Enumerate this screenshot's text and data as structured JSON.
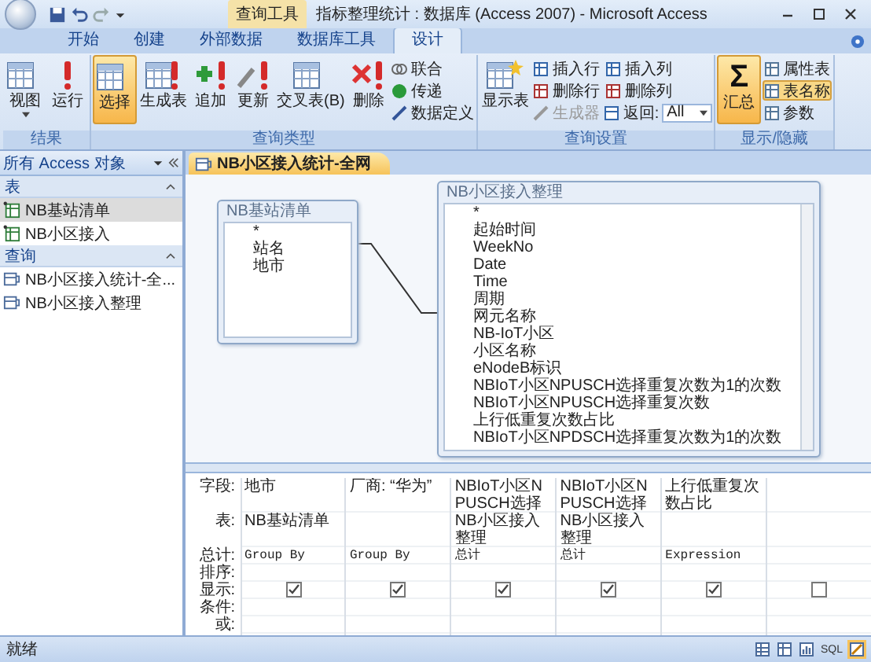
{
  "title_bar": {
    "context_tab": "查询工具",
    "title": "指标整理统计 : 数据库 (Access 2007) - Microsoft Access"
  },
  "ribbon_tabs": [
    {
      "label": "开始",
      "selected": false
    },
    {
      "label": "创建",
      "selected": false
    },
    {
      "label": "外部数据",
      "selected": false
    },
    {
      "label": "数据库工具",
      "selected": false
    },
    {
      "label": "设计",
      "selected": true
    }
  ],
  "ribbon_groups": [
    {
      "label": "结果",
      "large": [
        {
          "label": "视图",
          "kind": "grid",
          "selected": false,
          "dropdown": true
        },
        {
          "label": "运行",
          "kind": "exclaim",
          "selected": false
        }
      ]
    },
    {
      "label": "查询类型",
      "large": [
        {
          "label": "选择",
          "kind": "select",
          "selected": true
        },
        {
          "label": "生成表",
          "kind": "make-table",
          "selected": false
        },
        {
          "label": "追加",
          "kind": "append",
          "selected": false
        },
        {
          "label": "更新",
          "kind": "update",
          "selected": false
        },
        {
          "label": "交叉表(B)",
          "kind": "crosstab",
          "selected": false
        },
        {
          "label": "删除",
          "kind": "delete",
          "selected": false
        }
      ],
      "small": [
        {
          "label": "联合",
          "kind": "union",
          "disabled": false,
          "selected": false
        },
        {
          "label": "传递",
          "kind": "globe",
          "disabled": false,
          "selected": false
        },
        {
          "label": "数据定义",
          "kind": "pencil",
          "disabled": false,
          "selected": false
        }
      ]
    },
    {
      "label": "查询设置",
      "large": [
        {
          "label": "显示表",
          "kind": "show-table",
          "selected": false
        }
      ],
      "small": [
        {
          "label": "插入行",
          "kind": "insert-row",
          "disabled": false,
          "selected": false
        },
        {
          "label": "删除行",
          "kind": "delete-row",
          "disabled": false,
          "selected": false
        },
        {
          "label": "生成器",
          "kind": "builder",
          "disabled": true,
          "selected": false
        },
        {
          "label": "插入列",
          "kind": "insert-col",
          "disabled": false,
          "selected": false
        },
        {
          "label": "删除列",
          "kind": "delete-col",
          "disabled": false,
          "selected": false
        }
      ],
      "return": {
        "label": "返回:",
        "value": "All"
      }
    },
    {
      "label": "显示/隐藏",
      "large": [
        {
          "label": "汇总",
          "kind": "sigma",
          "symbol": "Σ",
          "selected": true
        }
      ],
      "small": [
        {
          "label": "属性表",
          "kind": "property",
          "disabled": false,
          "selected": false
        },
        {
          "label": "表名称",
          "kind": "table-names",
          "disabled": false,
          "selected": true
        },
        {
          "label": "参数",
          "kind": "params",
          "disabled": false,
          "selected": false
        }
      ]
    }
  ],
  "nav_pane": {
    "title": "所有 Access 对象",
    "sections": [
      {
        "label": "表",
        "items": [
          {
            "label": "NB基站清单",
            "kind": "table",
            "selected": true
          },
          {
            "label": "NB小区接入",
            "kind": "table",
            "selected": false
          }
        ]
      },
      {
        "label": "查询",
        "items": [
          {
            "label": "NB小区接入统计-全...",
            "kind": "query",
            "selected": false
          },
          {
            "label": "NB小区接入整理",
            "kind": "query",
            "selected": false
          }
        ]
      }
    ]
  },
  "document_tab": {
    "label": "NB小区接入统计-全网"
  },
  "tables": [
    {
      "title": "NB基站清单",
      "fields": [
        "*",
        "站名",
        "地市"
      ]
    },
    {
      "title": "NB小区接入整理",
      "fields": [
        "*",
        "起始时间",
        "WeekNo",
        "Date",
        "Time",
        "周期",
        "网元名称",
        "NB-IoT小区",
        "小区名称",
        "eNodeB标识",
        "NBIoT小区NPUSCH选择重复次数为1的次数",
        "NBIoT小区NPUSCH选择重复次数",
        "上行低重复次数占比",
        "NBIoT小区NPDSCH选择重复次数为1的次数"
      ]
    }
  ],
  "grid": {
    "row_labels": [
      "字段:",
      "表:",
      "总计:",
      "排序:",
      "显示:",
      "条件:",
      "或:"
    ],
    "columns": [
      {
        "field": "地市",
        "table": "NB基站清单",
        "total": "Group By",
        "show": true
      },
      {
        "field": "厂商: “华为”",
        "total": "Group By",
        "show": true
      },
      {
        "field": "NBIoT小区NPUSCH选择",
        "table": "NB小区接入整理",
        "total": "总计",
        "show": true
      },
      {
        "field": "NBIoT小区NPUSCH选择",
        "table": "NB小区接入整理",
        "total": "总计",
        "show": true
      },
      {
        "field": "上行低重复次数占比",
        "total": "Expression",
        "show": true
      },
      {
        "show": false
      }
    ]
  },
  "status_bar": {
    "text": "就绪",
    "views": [
      {
        "kind": "datasheet",
        "selected": false
      },
      {
        "kind": "pivot-table",
        "selected": false
      },
      {
        "kind": "pivot-chart",
        "selected": false
      },
      {
        "kind": "sql",
        "label": "SQL",
        "selected": false
      },
      {
        "kind": "design",
        "selected": true
      }
    ]
  }
}
